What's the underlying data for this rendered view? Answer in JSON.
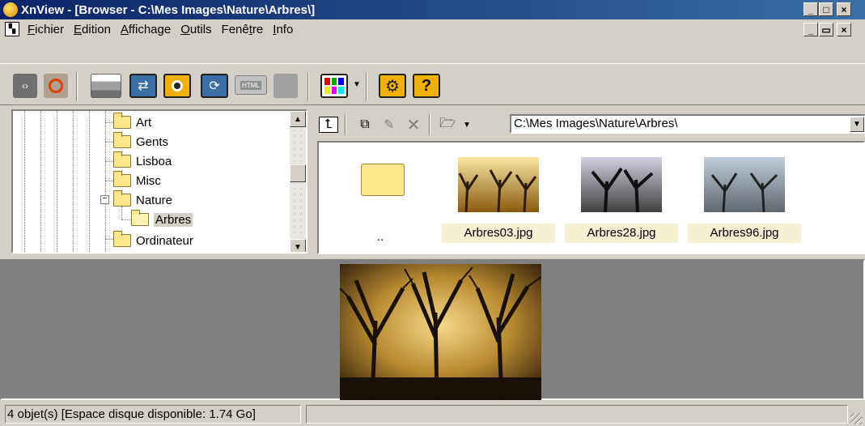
{
  "window": {
    "title": "XnView - [Browser - C:\\Mes Images\\Nature\\Arbres\\]",
    "caption_buttons": [
      "_",
      "□",
      "×"
    ],
    "mdi_buttons": [
      "_",
      "▭",
      "×"
    ]
  },
  "menu": {
    "items": [
      {
        "pre": "",
        "ul": "F",
        "post": "ichier"
      },
      {
        "pre": "",
        "ul": "E",
        "post": "dition"
      },
      {
        "pre": "",
        "ul": "A",
        "post": "ffichage"
      },
      {
        "pre": "",
        "ul": "O",
        "post": "utils"
      },
      {
        "pre": "Fenê",
        "ul": "t",
        "post": "re"
      },
      {
        "pre": "",
        "ul": "I",
        "post": "nfo"
      }
    ]
  },
  "toolbar": {
    "icons": [
      "arrows-icon",
      "refresh-icon",
      "printer-icon",
      "convert-icon",
      "camera-icon",
      "slideshow-icon",
      "html-icon",
      "blank-icon",
      "palette-icon",
      "settings-icon",
      "help-icon"
    ],
    "html_label": "HTML",
    "help_label": "?"
  },
  "tree": {
    "items": [
      {
        "label": "Art",
        "expanded": false
      },
      {
        "label": "Gents",
        "expanded": false
      },
      {
        "label": "Lisboa",
        "expanded": false
      },
      {
        "label": "Misc",
        "expanded": false
      },
      {
        "label": "Nature",
        "expanded": true
      },
      {
        "label": "Arbres",
        "expanded": false,
        "selected": true
      },
      {
        "label": "Ordinateur",
        "expanded": false
      }
    ],
    "expander_symbol": "−"
  },
  "browser_toolbar": {
    "path": "C:\\Mes Images\\Nature\\Arbres\\",
    "icons": [
      "up-folder-icon",
      "copy-icon",
      "rename-icon",
      "delete-icon",
      "folder-open-icon",
      "dropdown-arrow-icon"
    ]
  },
  "thumbnails": [
    {
      "label": "..",
      "kind": "parent-folder"
    },
    {
      "label": "Arbres03.jpg",
      "kind": "image"
    },
    {
      "label": "Arbres28.jpg",
      "kind": "image"
    },
    {
      "label": "Arbres96.jpg",
      "kind": "image"
    }
  ],
  "status": {
    "text": "4 objet(s) [Espace disque disponible: 1.74 Go]"
  },
  "colors": {
    "title_bar_start": "#0a246a",
    "title_bar_end": "#3a6ea5",
    "face": "#d4d0c8",
    "preview_bg": "#808080",
    "thumb_label_bg": "#f4efd0"
  }
}
